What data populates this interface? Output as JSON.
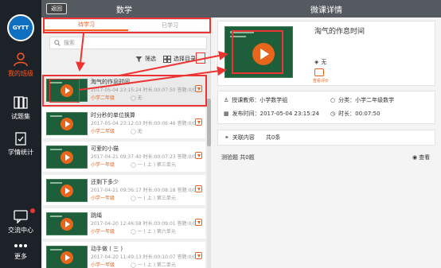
{
  "sidebar": {
    "logo_text": "GYTT",
    "items": [
      {
        "label": "我的班级",
        "icon": "person-icon",
        "active": true
      },
      {
        "label": "试题集",
        "icon": "books-icon",
        "active": false
      },
      {
        "label": "学情统计",
        "icon": "clipboard-check-icon",
        "active": false
      },
      {
        "label": "交流中心",
        "icon": "chat-icon",
        "active": false
      },
      {
        "label": "更多",
        "icon": "more-dots-icon",
        "active": false
      }
    ]
  },
  "middle": {
    "back_label": "返回",
    "title": "数学",
    "tabs": [
      {
        "label": "待学习",
        "active": true
      },
      {
        "label": "已学习",
        "active": false
      }
    ],
    "search_placeholder": "搜索",
    "filter_label": "筛选",
    "select_label": "选择目录",
    "items": [
      {
        "title": "淘气的作息时间",
        "date": "2017-05-04 23:15:24",
        "duration": "时长:00:07:50",
        "rank": "答题:0/0",
        "tag": "小学二年级",
        "unit": "无"
      },
      {
        "title": "时分秒的单位换算",
        "date": "2017-05-04 23:12:03",
        "duration": "时长:00:06:46",
        "rank": "答题:0/0",
        "tag": "小学二年级",
        "unit": "无"
      },
      {
        "title": "可爱的小猫",
        "date": "2017-04-21 09:37:40",
        "duration": "时长:00:07:23",
        "rank": "答题:0/0",
        "tag": "小学一年级",
        "unit": "一 ( 上 ) 第三单元"
      },
      {
        "title": "还剩下多少",
        "date": "2017-04-21 09:36:17",
        "duration": "时长:00:08:18",
        "rank": "答题:0/0",
        "tag": "小学一年级",
        "unit": "一 ( 上 ) 第三单元"
      },
      {
        "title": "跳绳",
        "date": "2017-04-20 12:46:58",
        "duration": "时长:00:09:01",
        "rank": "答题:0/0",
        "tag": "小学一年级",
        "unit": "一 ( 上 ) 第六单元"
      },
      {
        "title": "动手做 ( 三 )",
        "date": "2017-04-20 11:49:13",
        "duration": "时长:00:10:07",
        "rank": "答题:0/0",
        "tag": "小学一年级",
        "unit": "一 ( 上 ) 第二单元"
      }
    ]
  },
  "detail": {
    "header_title": "微课详情",
    "video_title": "淘气的作息时间",
    "tag_label": "无",
    "report_label": "查看评价",
    "teacher": "授课教师：小学数学组",
    "category": "分类：小学二年级数学",
    "publish_time": "发布时间：2017-05-04 23:15:24",
    "duration": "时长：00:07:50",
    "related_label": "关联内容",
    "related_count": "共0条",
    "quiz_label": "测验题 共0题",
    "view_label": "查看"
  },
  "colors": {
    "accent": "#e8651c",
    "annotation": "#e33333",
    "header": "#555a60",
    "sidebar": "#1d2128"
  }
}
